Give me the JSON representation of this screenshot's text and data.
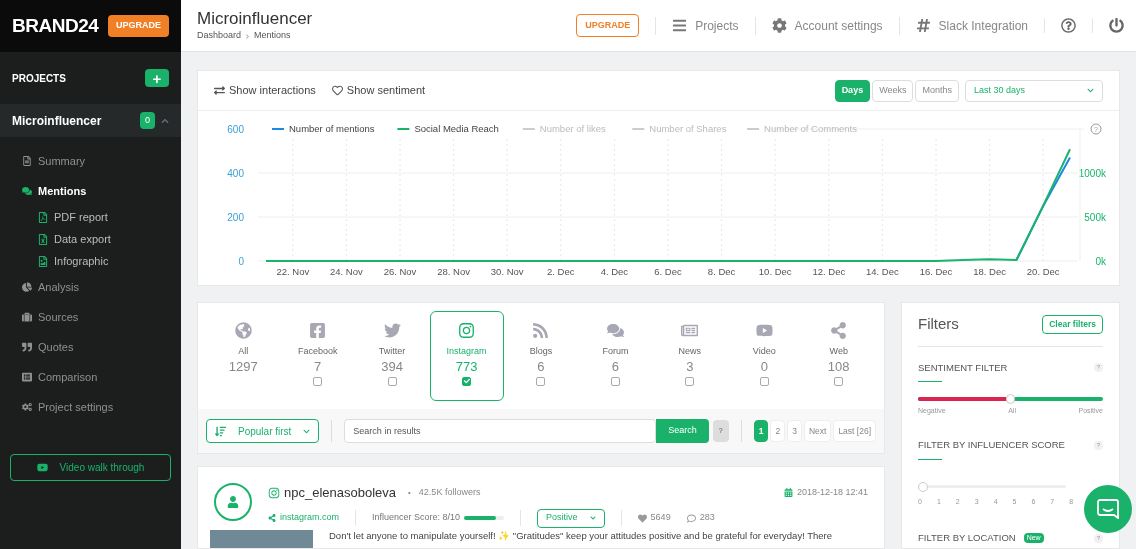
{
  "sidebar": {
    "logo": "BRAND24",
    "upgrade": "UPGRADE",
    "projects_label": "PROJECTS",
    "add": "+",
    "project": {
      "name": "Microinfluencer",
      "badge": "0",
      "expanded": true
    },
    "items": [
      {
        "label": "Summary",
        "selected": false
      },
      {
        "label": "Mentions",
        "selected": true,
        "children": [
          {
            "label": "PDF report"
          },
          {
            "label": "Data export"
          },
          {
            "label": "Infographic"
          }
        ]
      },
      {
        "label": "Analysis",
        "selected": false
      },
      {
        "label": "Sources",
        "selected": false
      },
      {
        "label": "Quotes",
        "selected": false
      },
      {
        "label": "Comparison",
        "selected": false
      },
      {
        "label": "Project settings",
        "selected": false
      }
    ],
    "video_button": "Video walk through"
  },
  "header": {
    "title": "Microinfluencer",
    "breadcrumb": [
      "Dashboard",
      "Mentions"
    ],
    "upgrade": "UPGRADE",
    "nav": [
      "Projects",
      "Account settings",
      "Slack Integration"
    ]
  },
  "chart_card": {
    "toggles": [
      "Show interactions",
      "Show sentiment"
    ],
    "periods": [
      {
        "label": "Days",
        "selected": true
      },
      {
        "label": "Weeks",
        "selected": false
      },
      {
        "label": "Months",
        "selected": false
      }
    ],
    "range": "Last 30 days",
    "legend": [
      {
        "label": "Number of likes",
        "enabled": false
      },
      {
        "label": "Number of Shares",
        "enabled": false
      },
      {
        "label": "Number of Comments",
        "enabled": false
      }
    ],
    "help": "?",
    "chart_data": {
      "type": "line",
      "categories": [
        null,
        "22. Nov",
        null,
        "24. Nov",
        null,
        "26. Nov",
        null,
        "28. Nov",
        null,
        "30. Nov",
        null,
        "2. Dec",
        null,
        "4. Dec",
        null,
        "6. Dec",
        null,
        "8. Dec",
        null,
        "10. Dec",
        null,
        "12. Dec",
        null,
        "14. Dec",
        null,
        "16. Dec",
        null,
        "18. Dec",
        null,
        "20. Dec",
        null
      ],
      "ylim": [
        0,
        600
      ],
      "yticks": [
        0,
        200,
        400,
        600
      ],
      "y2lim": [
        0,
        1500
      ],
      "y2ticks": [
        {
          "value": 1000,
          "label": "1000k"
        },
        {
          "value": 500,
          "label": "500k"
        },
        {
          "value": 0,
          "label": "0k"
        }
      ],
      "grid": true,
      "legend": "top",
      "series": [
        {
          "name": "Number of mentions",
          "color": "#1e88e5",
          "values": [
            null,
            null,
            null,
            null,
            null,
            null,
            null,
            null,
            null,
            null,
            null,
            null,
            null,
            null,
            null,
            null,
            null,
            null,
            null,
            null,
            null,
            null,
            null,
            null,
            null,
            null,
            null,
            null,
            4,
            250,
            470
          ]
        },
        {
          "name": "Social Media Reach",
          "color": "#19b36b",
          "axis": "y2",
          "values": [
            0,
            0,
            0,
            0,
            0,
            0,
            0,
            0,
            0,
            0,
            0,
            0,
            0,
            0,
            0,
            0,
            0,
            0,
            0,
            0,
            0,
            0,
            0,
            0,
            0,
            0,
            10,
            20,
            10,
            630,
            1270
          ]
        }
      ]
    }
  },
  "sources": [
    {
      "kind": "all",
      "label": "All",
      "count": "1297",
      "selected": false
    },
    {
      "kind": "network",
      "label": "Facebook",
      "count": "7",
      "selected": false,
      "checked": false
    },
    {
      "kind": "network",
      "label": "Twitter",
      "count": "394",
      "selected": false,
      "checked": false
    },
    {
      "kind": "network",
      "label": "Instagram",
      "count": "773",
      "selected": true,
      "checked": true
    },
    {
      "kind": "network",
      "label": "Blogs",
      "count": "6",
      "selected": false,
      "checked": false
    },
    {
      "kind": "network",
      "label": "Forum",
      "count": "6",
      "selected": false,
      "checked": false
    },
    {
      "kind": "network",
      "label": "News",
      "count": "3",
      "selected": false,
      "checked": false
    },
    {
      "kind": "network",
      "label": "Video",
      "count": "0",
      "selected": false,
      "checked": false
    },
    {
      "kind": "network",
      "label": "Web",
      "count": "108",
      "selected": false,
      "checked": false
    }
  ],
  "toolbar": {
    "sort": "Popular first",
    "search": {
      "placeholder": "Search in results"
    },
    "search_button": "Search",
    "help": "?",
    "pages": [
      {
        "label": "1",
        "selected": true
      },
      {
        "label": "2",
        "selected": false
      },
      {
        "label": "3",
        "selected": false
      },
      {
        "label": "Next",
        "selected": false
      },
      {
        "label": "Last [26]",
        "selected": false
      }
    ]
  },
  "filters": {
    "title": "Filters",
    "clear": "Clear filters",
    "sentiment": {
      "title": "SENTIMENT FILTER",
      "help": "?",
      "level": 0.5,
      "labels": [
        "Negative",
        "All",
        "Positive"
      ]
    },
    "influencer": {
      "title": "FILTER BY INFLUENCER SCORE",
      "help": "?",
      "level": 0,
      "ticks": [
        "0",
        "1",
        "2",
        "3",
        "4",
        "5",
        "6",
        "7",
        "8"
      ]
    },
    "location": {
      "title": "FILTER BY LOCATION",
      "badge": "New",
      "help": "?"
    }
  },
  "mention": {
    "author": "npc_elenasoboleva",
    "separator": "•",
    "followers": "42.5K followers",
    "date": "2018-12-18 12:41",
    "link": "instagram.com",
    "score_label": "Influencer Score: 8/10",
    "score": {
      "level": 0.8
    },
    "sentiment": "Positive",
    "likes": "5649",
    "comments": "283",
    "text": "Don't let anyone to manipulate yourself! ✨ \"Gratitudes\" keep your attitudes positive and be grateful for everyday! There"
  }
}
